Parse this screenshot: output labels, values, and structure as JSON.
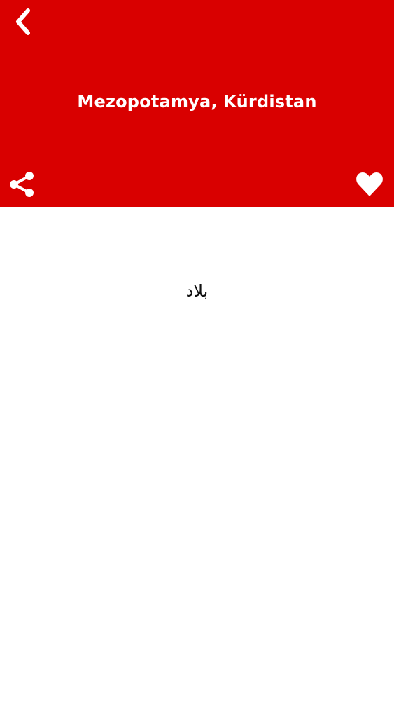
{
  "header": {
    "title": "Mezopotamya, Kürdistan"
  },
  "content": {
    "word": "بلاد"
  },
  "icons": {
    "back": "chevron-left-icon",
    "share": "share-icon",
    "favorite": "heart-icon"
  },
  "colors": {
    "header_background": "#d90000",
    "header_text": "#ffffff",
    "content_background": "#ffffff",
    "content_text": "#111111"
  }
}
